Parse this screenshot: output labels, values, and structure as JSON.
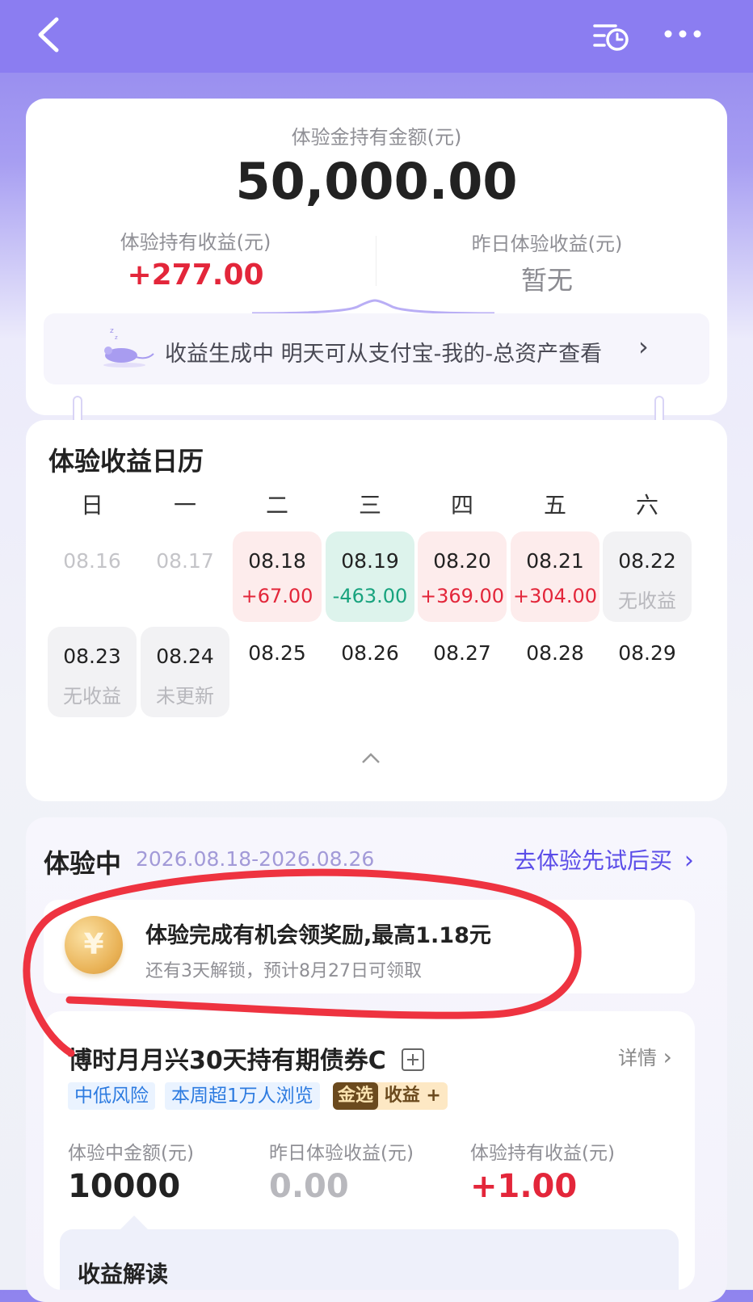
{
  "summary": {
    "title": "体验金持有金额(元)",
    "amount": "50,000.00",
    "hold_income_label": "体验持有收益(元)",
    "hold_income_value": "+277.00",
    "yesterday_label": "昨日体验收益(元)",
    "yesterday_value": "暂无",
    "notice": "收益生成中 明天可从支付宝-我的-总资产查看",
    "notice_arrow": "›"
  },
  "calendar": {
    "title": "体验收益日历",
    "weekdays": [
      "日",
      "一",
      "二",
      "三",
      "四",
      "五",
      "六"
    ],
    "row1": [
      {
        "date": "08.16",
        "value": ""
      },
      {
        "date": "08.17",
        "value": ""
      },
      {
        "date": "08.18",
        "value": "+67.00"
      },
      {
        "date": "08.19",
        "value": "-463.00"
      },
      {
        "date": "08.20",
        "value": "+369.00"
      },
      {
        "date": "08.21",
        "value": "+304.00"
      },
      {
        "date": "08.22",
        "value": "无收益"
      }
    ],
    "row2": [
      {
        "date": "08.23",
        "value": "无收益"
      },
      {
        "date": "08.24",
        "value": "未更新"
      },
      {
        "date": "08.25",
        "value": ""
      },
      {
        "date": "08.26",
        "value": ""
      },
      {
        "date": "08.27",
        "value": ""
      },
      {
        "date": "08.28",
        "value": ""
      },
      {
        "date": "08.29",
        "value": ""
      }
    ],
    "collapse_icon": "chevron-up-icon"
  },
  "experience": {
    "title": "体验中",
    "date_range": "2026.08.18-2026.08.26",
    "link": "去体验先试后买",
    "link_arrow": "›",
    "reward_title": "体验完成有机会领奖励,最高1.18元",
    "reward_sub": "还有3天解锁，预计8月27日可领取",
    "coin_symbol": "¥"
  },
  "fund": {
    "name": "博时月月兴30天持有期债券C",
    "detail": "详情",
    "detail_arrow": "›",
    "tags": [
      "中低风险",
      "本周超1万人浏览"
    ],
    "gold_tag_a": "金选",
    "gold_tag_b": "收益",
    "gold_tag_plus": "+",
    "stats": [
      {
        "label": "体验中金额(元)",
        "value": "10000"
      },
      {
        "label": "昨日体验收益(元)",
        "value": "0.00"
      },
      {
        "label": "体验持有收益(元)",
        "value": "+1.00"
      }
    ],
    "bottom_label": "收益解读"
  },
  "colors": {
    "header": "#8b7df1",
    "red": "#e3263a",
    "green": "#18a37e",
    "accent": "#6b5cf0",
    "annotation": "#ee3340"
  }
}
